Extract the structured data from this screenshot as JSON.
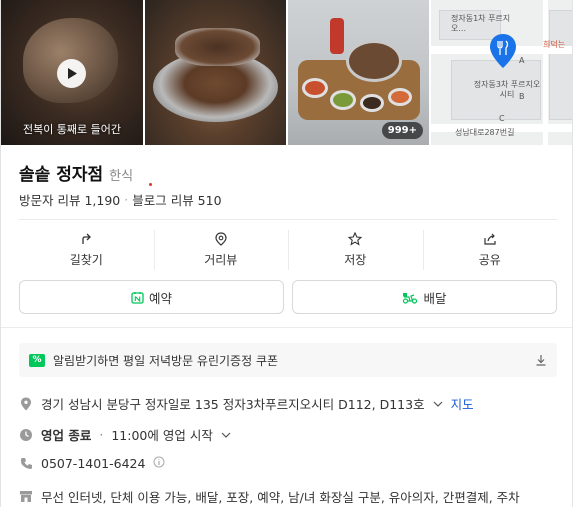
{
  "photos": {
    "video_caption": "전복이 통째로 들어간",
    "photo_count": "999+",
    "map_labels": {
      "top_place": "정자동1차 푸르지오...",
      "pin_place": "정자동3차 푸르지오시티",
      "street": "성남대로287번길",
      "corner": "희덕는",
      "block_a": "A",
      "block_b": "B",
      "block_c": "C"
    }
  },
  "place": {
    "name": "솔솥 정자점",
    "category": "한식",
    "visitor_reviews": "방문자 리뷰 1,190",
    "blog_reviews": "블로그 리뷰 510"
  },
  "actions": [
    {
      "label": "길찾기",
      "icon": "directions-icon"
    },
    {
      "label": "거리뷰",
      "icon": "street-view-pin-icon"
    },
    {
      "label": "저장",
      "icon": "star-icon"
    },
    {
      "label": "공유",
      "icon": "share-icon"
    }
  ],
  "buttons": {
    "reserve": "예약",
    "delivery": "배달"
  },
  "coupon": {
    "icon_text": "%",
    "text": "알림받기하면 평일 저녁방문 유린기증정 쿠폰"
  },
  "info": {
    "address": "경기 성남시 분당구 정자일로 135 정자3차푸르지오시티 D112, D113호",
    "map_link": "지도",
    "hours_status": "영업 종료",
    "hours_detail": "11:00에 영업 시작",
    "phone": "0507-1401-6424",
    "amenities": "무선 인터넷, 단체 이용 가능, 배달, 포장, 예약, 남/녀 화장실 구분, 유아의자, 간편결제, 주차"
  },
  "colors": {
    "naver_green": "#03c75a",
    "link_blue": "#1a5bd8",
    "map_pin_blue": "#1a73e8",
    "delivery_green": "#03c75a"
  }
}
